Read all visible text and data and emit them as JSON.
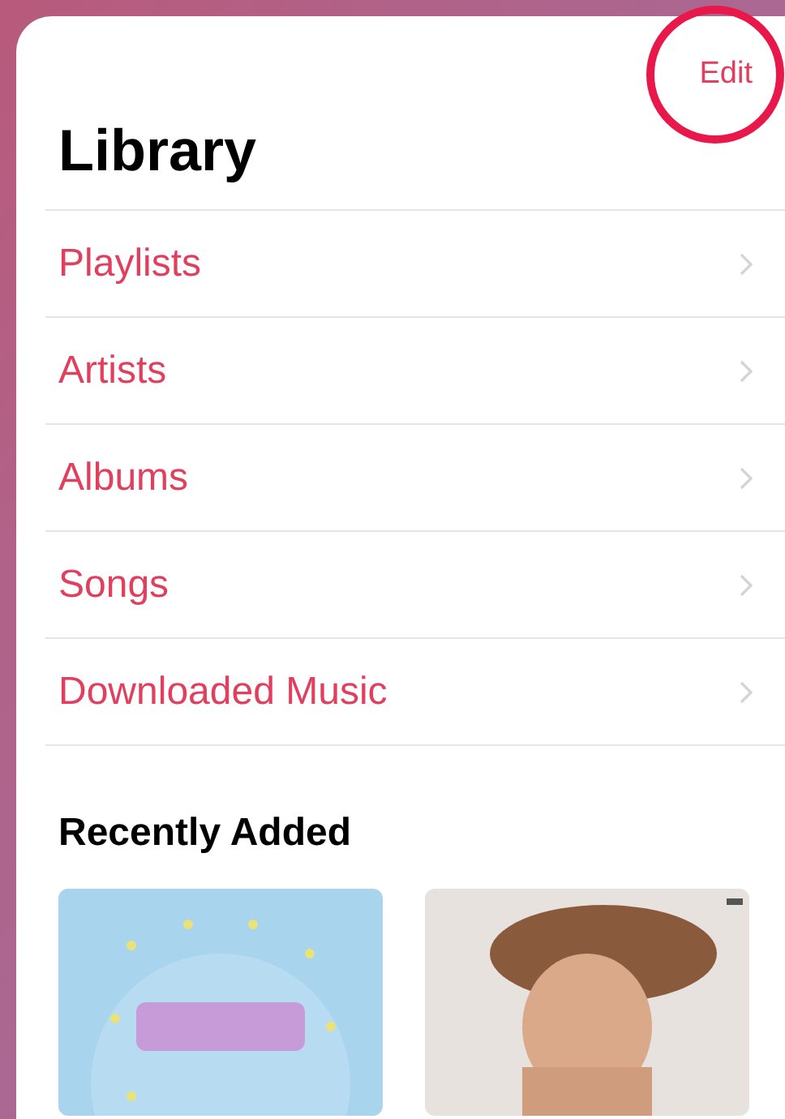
{
  "nav": {
    "edit": {
      "label": "Edit",
      "highlighted": true
    }
  },
  "title": "Library",
  "items": [
    {
      "label": "Playlists"
    },
    {
      "label": "Artists"
    },
    {
      "label": "Albums"
    },
    {
      "label": "Songs"
    },
    {
      "label": "Downloaded Music"
    }
  ],
  "recently_added": {
    "title": "Recently Added"
  }
}
